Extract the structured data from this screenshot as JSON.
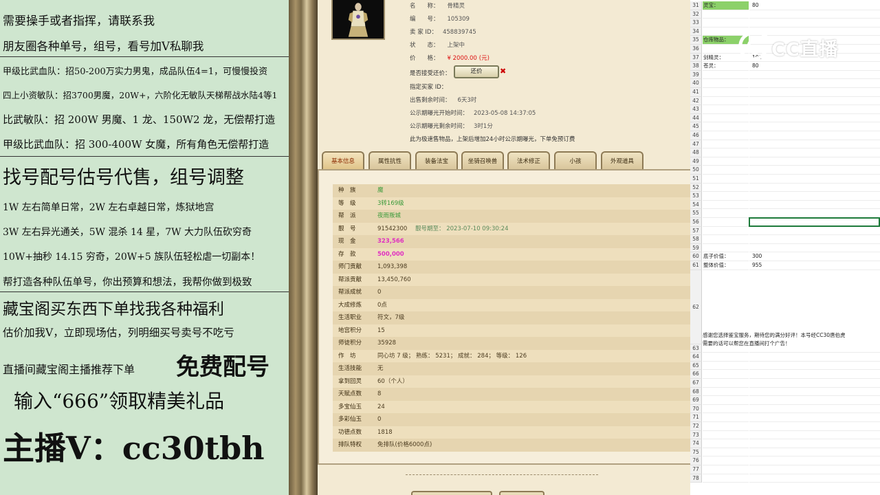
{
  "left_panel": {
    "lines": [
      "需要操手或者指挥，请联系我",
      "朋友圈各种单号，组号，看号加Ⅴ私聊我",
      "甲级比武血队：招50-200万实力男鬼，成品队伍4=1，可慢慢投资",
      "四上小资敏队：招3700男魔，20W+，六阶化无敏队天梯帮战水陆4等1",
      "比武敏队：招 200W 男魔、1 龙、150W2 龙，无偿帮打造",
      "甲级比武血队：招 300-400W 女魔，所有角色无偿帮打造",
      "找号配号估号代售，组号调整",
      "1W 左右简单日常，2W 左右卓越日常，炼狱地宫",
      "3W 左右异光通关，5W 混杀 14 星，7W 大力队伍砍穷奇",
      "10W+抽秒 14.15 穷奇，20W+5 族队伍轻松虐一切副本！",
      "帮打造各种队伍单号，你出预算和想法，我帮你做到极致",
      "藏宝阁买东西下单找我各种福利",
      "估价加我Ⅴ，立即现场估，列明细买号卖号不吃亏",
      "直播间藏宝阁主播推荐下单",
      "免费配号",
      "输入“666”领取精美礼品",
      "主播Ⅴ：cc30tbh"
    ]
  },
  "item": {
    "name_label": "名　　称：",
    "name_value": "骨精灵",
    "id_label": "编　　号：",
    "id_value": "105309",
    "seller_label": "卖 家 ID：",
    "seller_value": "458839745",
    "status_label": "状　　态：",
    "status_value": "上架中",
    "price_label": "价　　格：",
    "price_value": "¥ 2000.00",
    "price_unit": "(元)",
    "bargain_label": "是否接受还价：",
    "bargain_button": "还价",
    "buyer_label": "指定买家 ID：",
    "remain_label": "出售剩余时间：",
    "remain_value": "6天3时",
    "start_label": "公示期曝光开始时间：",
    "start_value": "2023-05-08 14:37:05",
    "left_label": "公示期曝光剩余时间：",
    "left_value": "3时1分",
    "note": "此为极速售物品，上架后增加24小时公示期曝光，下单免预订费"
  },
  "tabs": [
    "基本信息",
    "属性抗性",
    "装备法宝",
    "坐骑召唤兽",
    "法术修正",
    "小孩",
    "外观道具"
  ],
  "info_rows": [
    {
      "label": "种　族",
      "value": "魔",
      "cls": "c-green"
    },
    {
      "label": "等　级",
      "value": "3转169级",
      "cls": "c-green"
    },
    {
      "label": "帮　派",
      "value": "夜雨叛城",
      "cls": "c-green"
    },
    {
      "label": "靓　号",
      "value": "91542300",
      "extra": "  靓号期至：  2023-07-10 09:30:24",
      "cls": ""
    },
    {
      "label": "现　金",
      "value": "323,566",
      "cls": "c-pink"
    },
    {
      "label": "存　款",
      "value": "500,000",
      "cls": "c-pink"
    },
    {
      "label": "师门贡献",
      "value": "1,093,398",
      "cls": ""
    },
    {
      "label": "帮派贡献",
      "value": "13,450,760",
      "cls": ""
    },
    {
      "label": "帮派成就",
      "value": "0",
      "cls": ""
    },
    {
      "label": "大成修炼",
      "value": "0点",
      "cls": ""
    },
    {
      "label": "生活职业",
      "value": "符文，7级",
      "cls": ""
    },
    {
      "label": "地宫积分",
      "value": "15",
      "cls": ""
    },
    {
      "label": "师徒积分",
      "value": "35928",
      "cls": ""
    },
    {
      "label": "作　坊",
      "value": "同心坊 7 级；  熟练：  5231；  成就：  284；  等级：  126",
      "cls": ""
    },
    {
      "label": "生活技能",
      "value": "无",
      "cls": ""
    },
    {
      "label": "拿到回灵",
      "value": "60（个人）",
      "cls": ""
    },
    {
      "label": "天赋点数",
      "value": "8",
      "cls": ""
    },
    {
      "label": "多宝仙玉",
      "value": "24",
      "cls": ""
    },
    {
      "label": "多彩仙玉",
      "value": "0",
      "cls": ""
    },
    {
      "label": "功德点数",
      "value": "1818",
      "cls": ""
    },
    {
      "label": "排队特权",
      "value": "免排队(价格6000点)",
      "cls": ""
    }
  ],
  "sheet": {
    "rows": [
      {
        "n": "31",
        "a": "灵宝：",
        "b": "80",
        "hlA": true
      },
      {
        "n": "32",
        "a": "",
        "b": ""
      },
      {
        "n": "33",
        "a": "",
        "b": ""
      },
      {
        "n": "34",
        "a": "",
        "b": ""
      },
      {
        "n": "35",
        "a": "仓库物品：",
        "b": "",
        "hlA": true
      },
      {
        "n": "36",
        "a": "",
        "b": ""
      },
      {
        "n": "37",
        "a": "剑精灵：",
        "b": "100"
      },
      {
        "n": "38",
        "a": "苍灵：",
        "b": "80"
      },
      {
        "n": "39",
        "a": "",
        "b": ""
      },
      {
        "n": "40",
        "a": "",
        "b": ""
      },
      {
        "n": "41",
        "a": "",
        "b": ""
      },
      {
        "n": "42",
        "a": "",
        "b": ""
      },
      {
        "n": "43",
        "a": "",
        "b": ""
      },
      {
        "n": "44",
        "a": "",
        "b": ""
      },
      {
        "n": "45",
        "a": "",
        "b": ""
      },
      {
        "n": "46",
        "a": "",
        "b": ""
      },
      {
        "n": "47",
        "a": "",
        "b": ""
      },
      {
        "n": "48",
        "a": "",
        "b": ""
      },
      {
        "n": "49",
        "a": "",
        "b": ""
      },
      {
        "n": "50",
        "a": "",
        "b": ""
      },
      {
        "n": "51",
        "a": "",
        "b": ""
      },
      {
        "n": "52",
        "a": "",
        "b": ""
      },
      {
        "n": "53",
        "a": "",
        "b": ""
      },
      {
        "n": "54",
        "a": "",
        "b": ""
      },
      {
        "n": "55",
        "a": "",
        "b": ""
      },
      {
        "n": "56",
        "a": "",
        "b": ""
      },
      {
        "n": "57",
        "a": "",
        "b": ""
      },
      {
        "n": "58",
        "a": "",
        "b": ""
      },
      {
        "n": "59",
        "a": "",
        "b": ""
      },
      {
        "n": "60",
        "a": "底子价值：",
        "b": "300"
      },
      {
        "n": "61",
        "a": "整体价值：",
        "b": "955"
      }
    ],
    "row62": "62",
    "thanks_1": "感谢您选择鉴宝服务，期待您的满分好评！本号经CC30唐伯虎",
    "thanks_2": "需要的话可以帮您在直播间打个广告！",
    "rows_after": [
      "63",
      "64",
      "65",
      "66",
      "67",
      "68",
      "69",
      "70",
      "71",
      "72",
      "73",
      "74",
      "75",
      "76",
      "77",
      "78"
    ]
  },
  "logo": {
    "text": "CC直播"
  }
}
